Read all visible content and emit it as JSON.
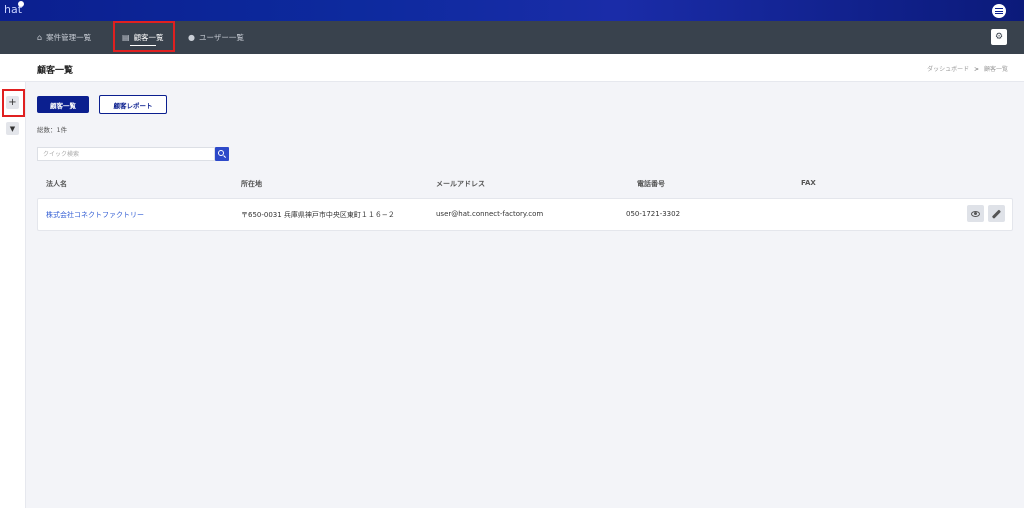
{
  "brand": {
    "name": "hat"
  },
  "nav": {
    "items": [
      {
        "icon": "home-icon",
        "label": "案件管理一覧"
      },
      {
        "icon": "document-icon",
        "label": "顧客一覧"
      },
      {
        "icon": "user-icon",
        "label": "ユーザー一覧"
      }
    ]
  },
  "page": {
    "title": "顧客一覧",
    "breadcrumb": {
      "home": "ダッシュボード",
      "separator": ">",
      "current": "顧客一覧"
    }
  },
  "sidebar": {
    "tools": [
      {
        "icon": "plus-icon",
        "glyph": "+"
      },
      {
        "icon": "filter-icon",
        "glyph": "▼"
      }
    ]
  },
  "toolbar": {
    "list_label": "顧客一覧",
    "report_label": "顧客レポート"
  },
  "summary": {
    "count_text": "総数：1件"
  },
  "search": {
    "placeholder": "クイック検索",
    "value": ""
  },
  "table": {
    "columns": [
      "法人名",
      "所在地",
      "メールアドレス",
      "電話番号",
      "FAX"
    ],
    "rows": [
      {
        "name": "株式会社コネクトファクトリー",
        "address": "〒650-0031 兵庫県神戸市中央区東町１１６−２",
        "email": "user@hat.connect-factory.com",
        "phone": "050-1721-3302",
        "fax": ""
      }
    ]
  },
  "colors": {
    "brand": "#0b1f8f",
    "navbar": "#39424d",
    "link": "#2f5bd3",
    "highlight": "#e02020",
    "background": "#f3f4f8"
  }
}
